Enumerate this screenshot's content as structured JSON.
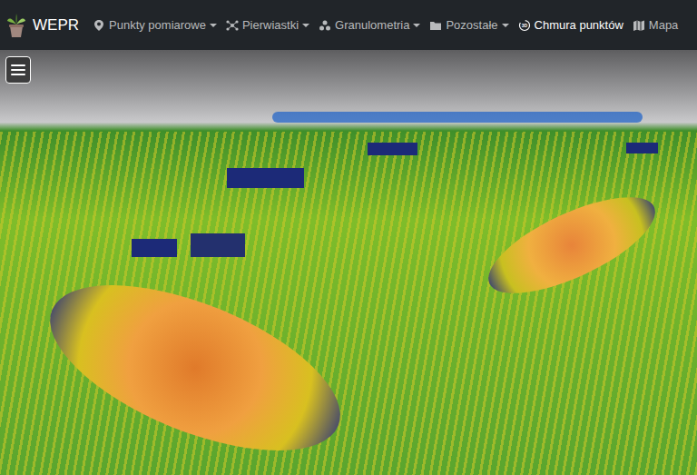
{
  "navbar": {
    "brand": "WEPR",
    "items": [
      {
        "label": "Punkty pomiarowe",
        "icon": "pin",
        "dropdown": true,
        "selected": false
      },
      {
        "label": "Pierwiastki",
        "icon": "atom",
        "dropdown": true,
        "selected": false
      },
      {
        "label": "Granulometria",
        "icon": "grains",
        "dropdown": true,
        "selected": false
      },
      {
        "label": "Pozostałe",
        "icon": "folder",
        "dropdown": true,
        "selected": false
      },
      {
        "label": "Chmura punktów",
        "icon": "cube3d",
        "dropdown": false,
        "selected": true
      },
      {
        "label": "Mapa",
        "icon": "map",
        "dropdown": false,
        "selected": false
      }
    ]
  }
}
